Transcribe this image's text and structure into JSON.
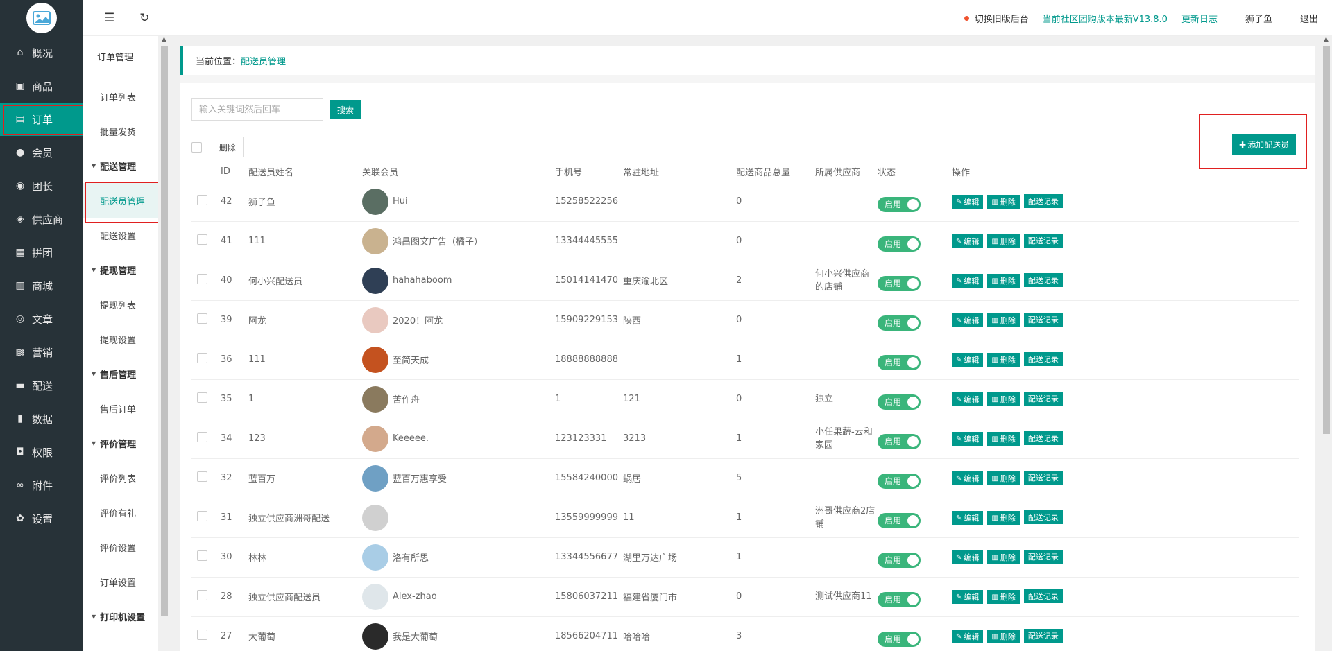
{
  "nav": {
    "items": [
      {
        "label": "概况",
        "icon": "home-icon",
        "glyph": "⌂"
      },
      {
        "label": "商品",
        "icon": "goods-icon",
        "glyph": "▣"
      },
      {
        "label": "订单",
        "icon": "order-icon",
        "glyph": "▤",
        "active": true
      },
      {
        "label": "会员",
        "icon": "member-icon",
        "glyph": "●"
      },
      {
        "label": "团长",
        "icon": "leader-icon",
        "glyph": "◉"
      },
      {
        "label": "供应商",
        "icon": "supplier-icon",
        "glyph": "◈"
      },
      {
        "label": "拼团",
        "icon": "group-icon",
        "glyph": "▦"
      },
      {
        "label": "商城",
        "icon": "store-icon",
        "glyph": "▥"
      },
      {
        "label": "文章",
        "icon": "compass-icon",
        "glyph": "◎"
      },
      {
        "label": "营销",
        "icon": "gift-icon",
        "glyph": "▩"
      },
      {
        "label": "配送",
        "icon": "truck-icon",
        "glyph": "▬"
      },
      {
        "label": "数据",
        "icon": "chart-icon",
        "glyph": "▮"
      },
      {
        "label": "权限",
        "icon": "lock-icon",
        "glyph": "◘"
      },
      {
        "label": "附件",
        "icon": "link-icon",
        "glyph": "∞"
      },
      {
        "label": "设置",
        "icon": "gear-icon",
        "glyph": "✿"
      }
    ]
  },
  "subnav": {
    "title": "订单管理",
    "items": [
      {
        "label": "订单列表",
        "type": "item"
      },
      {
        "label": "批量发货",
        "type": "item"
      },
      {
        "label": "配送管理",
        "type": "head"
      },
      {
        "label": "配送员管理",
        "type": "item",
        "active": true
      },
      {
        "label": "配送设置",
        "type": "item"
      },
      {
        "label": "提现管理",
        "type": "head"
      },
      {
        "label": "提现列表",
        "type": "item"
      },
      {
        "label": "提现设置",
        "type": "item"
      },
      {
        "label": "售后管理",
        "type": "head"
      },
      {
        "label": "售后订单",
        "type": "item"
      },
      {
        "label": "评价管理",
        "type": "head"
      },
      {
        "label": "评价列表",
        "type": "item"
      },
      {
        "label": "评价有礼",
        "type": "item"
      },
      {
        "label": "评价设置",
        "type": "item"
      },
      {
        "label": "订单设置",
        "type": "item"
      },
      {
        "label": "打印机设置",
        "type": "head"
      }
    ]
  },
  "topbar": {
    "switch_old": "切换旧版后台",
    "version": "当前社区团购版本最新V13.8.0",
    "changelog": "更新日志",
    "username": "狮子鱼",
    "logout": "退出"
  },
  "breadcrumb": {
    "prefix": "当前位置：",
    "current": "配送员管理"
  },
  "search": {
    "placeholder": "输入关键词然后回车",
    "button": "搜索"
  },
  "bulk": {
    "delete": "删除"
  },
  "add_button": "添加配送员",
  "table": {
    "headers": [
      "ID",
      "配送员姓名",
      "关联会员",
      "手机号",
      "常驻地址",
      "配送商品总量",
      "所属供应商",
      "状态",
      "操作"
    ],
    "status_label": "启用",
    "actions": {
      "edit": "编辑",
      "delete": "删除",
      "record": "配送记录"
    },
    "rows": [
      {
        "id": "42",
        "name": "狮子鱼",
        "member": "Hui",
        "phone": "15258522256",
        "address": "",
        "total": "0",
        "supplier": "",
        "avatar": "#5a6e63"
      },
      {
        "id": "41",
        "name": "111",
        "member": "鸿昌图文广告（橘子）",
        "phone": "13344445555",
        "address": "",
        "total": "0",
        "supplier": "",
        "avatar": "#c9b28f"
      },
      {
        "id": "40",
        "name": "何小兴配送员",
        "member": "hahahaboom",
        "phone": "15014141470",
        "address": "重庆渝北区",
        "total": "2",
        "supplier": "何小兴供应商的店铺",
        "avatar": "#2f3f55"
      },
      {
        "id": "39",
        "name": "阿龙",
        "member": "2020！阿龙",
        "phone": "15909229153",
        "address": "陕西",
        "total": "0",
        "supplier": "",
        "avatar": "#e9c9c0"
      },
      {
        "id": "36",
        "name": "111",
        "member": "至简天成",
        "phone": "18888888888",
        "address": "",
        "total": "1",
        "supplier": "",
        "avatar": "#c4521f"
      },
      {
        "id": "35",
        "name": "1",
        "member": "苦作舟",
        "phone": "1",
        "address": "121",
        "total": "0",
        "supplier": "独立",
        "avatar": "#8a7a5e"
      },
      {
        "id": "34",
        "name": "123",
        "member": "Keeeee.",
        "phone": "123123331",
        "address": "3213",
        "total": "1",
        "supplier": "小任果蔬-云和家园",
        "avatar": "#d3a98c"
      },
      {
        "id": "32",
        "name": "蓝百万",
        "member": "蓝百万惠享受",
        "phone": "15584240000",
        "address": "蜗居",
        "total": "5",
        "supplier": "",
        "avatar": "#6fa0c4"
      },
      {
        "id": "31",
        "name": "独立供应商洲哥配送",
        "member": "",
        "phone": "13559999999",
        "address": "11",
        "total": "1",
        "supplier": "洲哥供应商2店铺",
        "avatar": "#d0d0d0"
      },
      {
        "id": "30",
        "name": "林林",
        "member": "洛有所思",
        "phone": "13344556677",
        "address": "湖里万达广场",
        "total": "1",
        "supplier": "",
        "avatar": "#a9cde6"
      },
      {
        "id": "28",
        "name": "独立供应商配送员",
        "member": "Alex-zhao",
        "phone": "15806037211",
        "address": "福建省厦门市",
        "total": "0",
        "supplier": "测试供应商11",
        "avatar": "#dfe6ea"
      },
      {
        "id": "27",
        "name": "大葡萄",
        "member": "我是大葡萄",
        "phone": "18566204711",
        "address": "哈哈哈",
        "total": "3",
        "supplier": "",
        "avatar": "#2a2a2a"
      }
    ]
  }
}
